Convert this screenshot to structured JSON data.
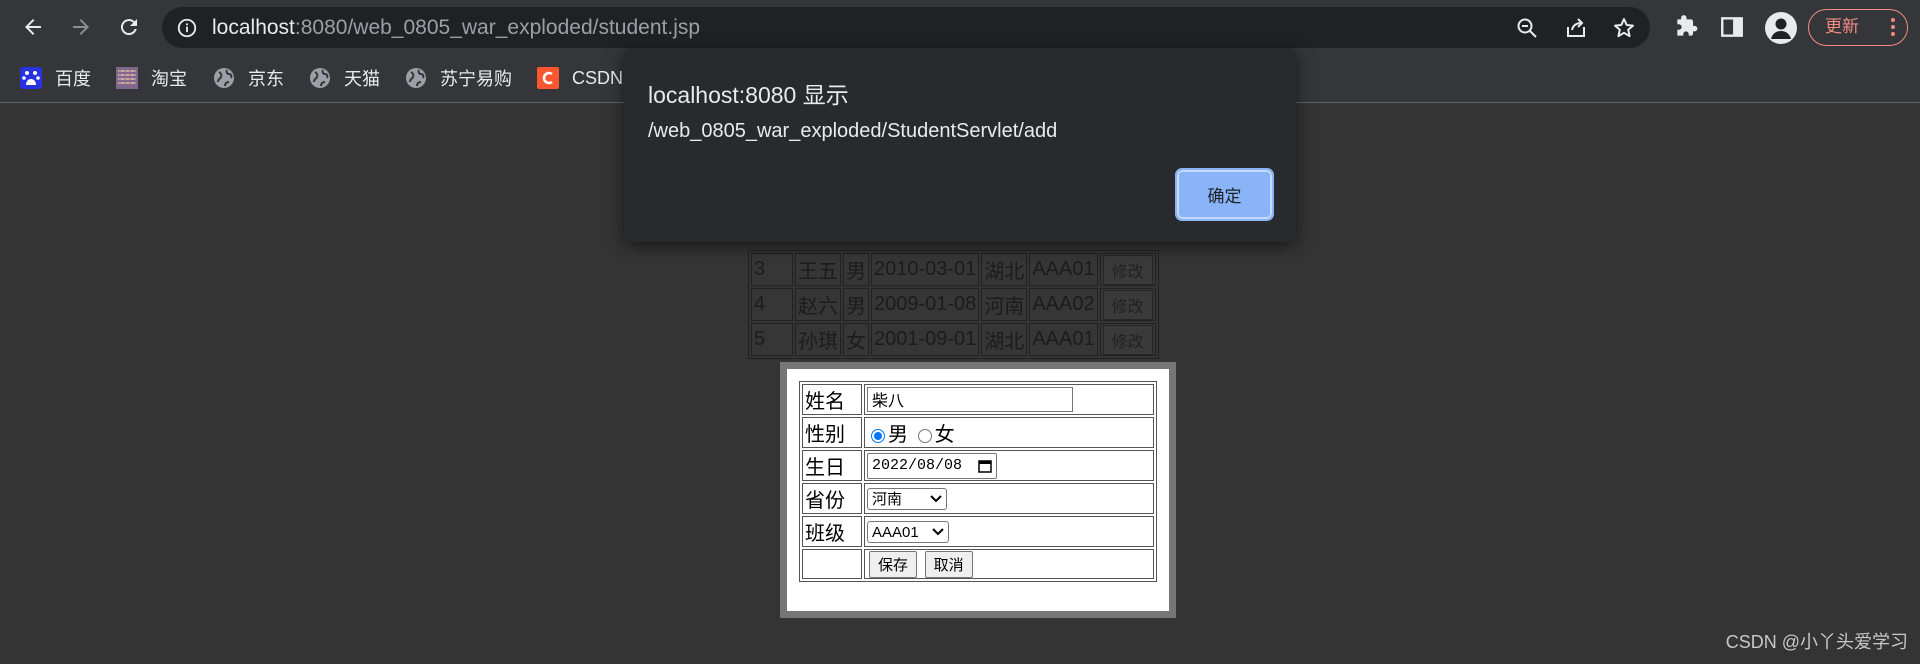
{
  "browser": {
    "url_host": "localhost",
    "url_rest": ":8080/web_0805_war_exploded/student.jsp",
    "update_label": "更新"
  },
  "bookmarks": [
    {
      "label": "百度",
      "icon": "baidu-icon"
    },
    {
      "label": "淘宝",
      "icon": "taobao-icon"
    },
    {
      "label": "京东",
      "icon": "globe-icon"
    },
    {
      "label": "天猫",
      "icon": "globe-icon"
    },
    {
      "label": "苏宁易购",
      "icon": "globe-icon"
    },
    {
      "label": "CSDN",
      "icon": "csdn-icon"
    }
  ],
  "alert": {
    "title": "localhost:8080 显示",
    "message": "/web_0805_war_exploded/StudentServlet/add",
    "ok_label": "确定"
  },
  "students": {
    "rows": [
      {
        "id": "3",
        "name": "王五",
        "gender": "男",
        "birthday": "2010-03-01",
        "province": "湖北",
        "class": "AAA01",
        "action": "修改"
      },
      {
        "id": "4",
        "name": "赵六",
        "gender": "男",
        "birthday": "2009-01-08",
        "province": "河南",
        "class": "AAA02",
        "action": "修改"
      },
      {
        "id": "5",
        "name": "孙琪",
        "gender": "女",
        "birthday": "2001-09-01",
        "province": "湖北",
        "class": "AAA01",
        "action": "修改"
      }
    ]
  },
  "form": {
    "name_label": "姓名",
    "name_value": "柴八",
    "gender_label": "性别",
    "gender_male": "男",
    "gender_female": "女",
    "birthday_label": "生日",
    "birthday_value": "2022/08/08",
    "province_label": "省份",
    "province_value": "河南",
    "class_label": "班级",
    "class_value": "AAA01",
    "save_label": "保存",
    "cancel_label": "取消"
  },
  "watermark": "CSDN @小丫头爱学习",
  "colors": {
    "chrome_bg": "#35363a",
    "omnibox_bg": "#202124",
    "dialog_bg": "#292a2d",
    "accent_blue": "#8ab4f8",
    "update_red": "#f28b82"
  }
}
